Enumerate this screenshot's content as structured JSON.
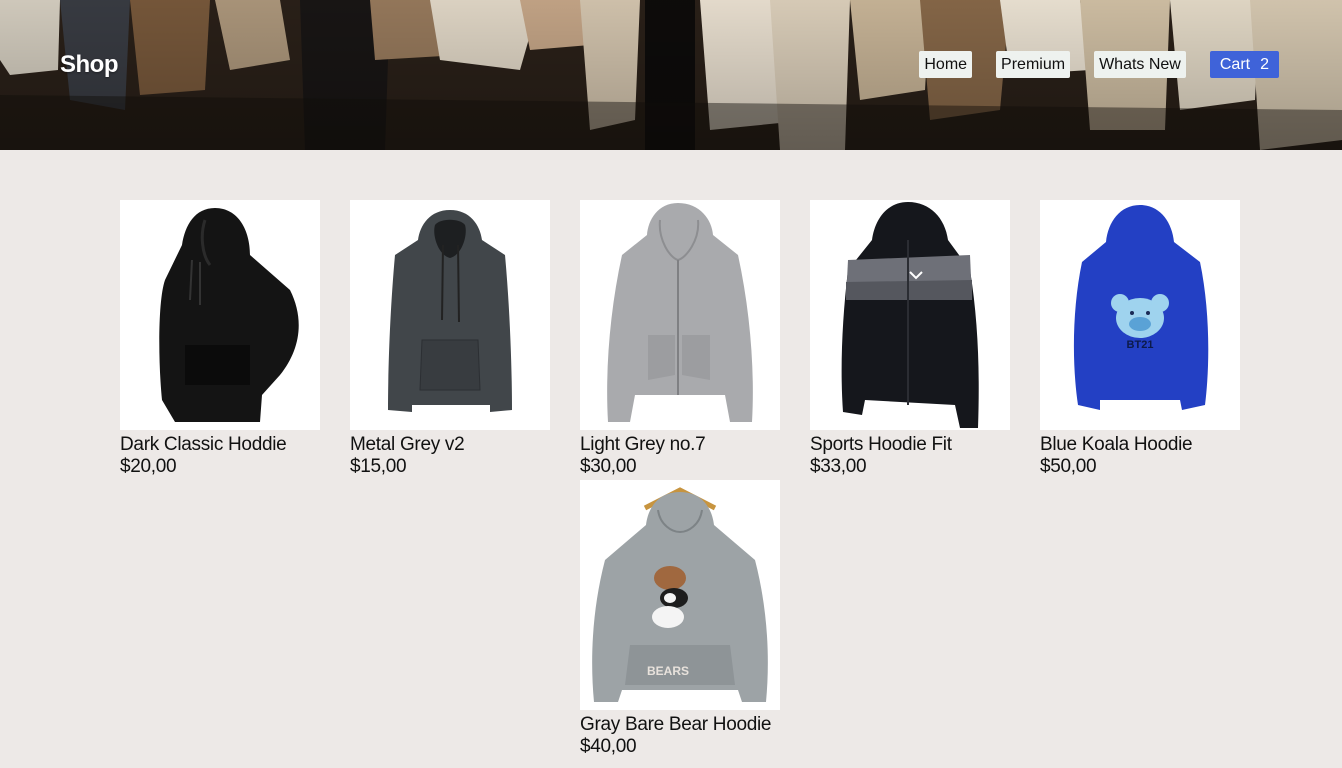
{
  "header": {
    "brand": "Shop",
    "nav": [
      {
        "label": "Home"
      },
      {
        "label": "Premium"
      },
      {
        "label": "Whats New"
      }
    ],
    "cart": {
      "label": "Cart",
      "count": "2"
    }
  },
  "products": [
    {
      "name": "Dark Classic Hoddie",
      "price": "$20,00",
      "color": "#141414",
      "icon": "black-hoodie-image"
    },
    {
      "name": "Metal Grey v2",
      "price": "$15,00",
      "color": "#3f4448",
      "icon": "dark-grey-hoodie-image"
    },
    {
      "name": "Light Grey no.7",
      "price": "$30,00",
      "color": "#a9aaad",
      "icon": "light-grey-zip-hoodie-image"
    },
    {
      "name": "Sports Hoodie Fit",
      "price": "$33,00",
      "color": "#15171c",
      "icon": "sports-zip-hoodie-image"
    },
    {
      "name": "Blue Koala Hoodie",
      "price": "$50,00",
      "color": "#2340c4",
      "icon": "blue-koala-hoodie-image",
      "print": "BT21"
    },
    {
      "name": "Gray Bare Bear Hoodie",
      "price": "$40,00",
      "color": "#9da3a6",
      "icon": "bare-bears-hoodie-image",
      "print": "BEARS"
    }
  ]
}
